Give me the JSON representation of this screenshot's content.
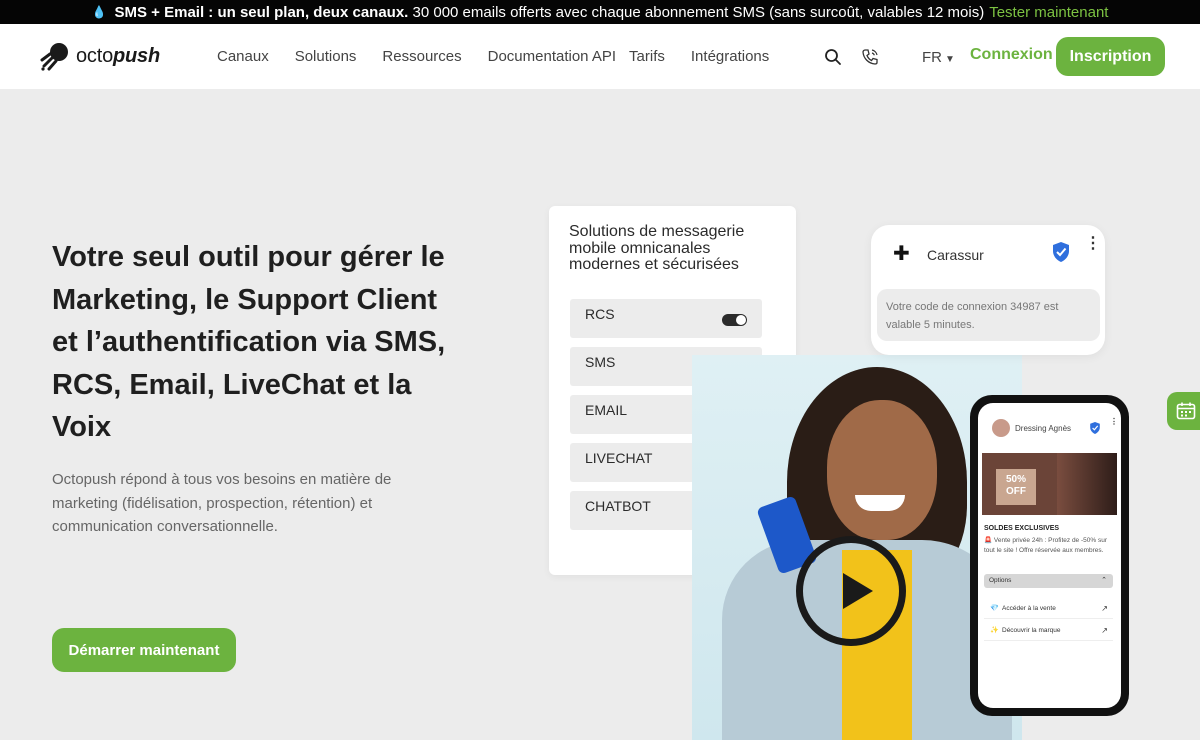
{
  "announcement": {
    "bold": "SMS + Email : un seul plan, deux canaux.",
    "text": "30 000 emails offerts avec chaque abonnement SMS (sans surcoût, valables 12 mois)",
    "cta": "Tester maintenant"
  },
  "header": {
    "logo_light": "octo",
    "logo_bold": "push",
    "nav": [
      "Canaux",
      "Solutions",
      "Ressources",
      "Documentation API",
      "Tarifs",
      "Intégrations"
    ],
    "lang": "FR",
    "login": "Connexion",
    "signup": "Inscription"
  },
  "hero": {
    "title": "Votre seul outil pour gérer le Marketing, le Support Client et l’authentification via SMS, RCS, Email, LiveChat et la Voix",
    "description": "Octopush répond à tous vos besoins en matière de marketing (fidélisation, prospection, rétention) et communication conversationnelle.",
    "cta": "Démarrer maintenant"
  },
  "solutions_card": {
    "title": "Solutions de messagerie mobile omnicanales modernes et sécurisées",
    "channels": [
      "RCS",
      "SMS",
      "EMAIL",
      "LIVECHAT",
      "CHATBOT"
    ]
  },
  "notification": {
    "sender": "Carassur",
    "message": "Votre code de connexion 34987 est valable 5 minutes."
  },
  "phone": {
    "brand": "Dressing Agnès",
    "promo": "50% OFF",
    "sale_title": "SOLDES EXCLUSIVES",
    "sale_text": "🚨 Vente privée 24h : Profitez de -50% sur tout le site ! Offre réservée aux membres.",
    "options_label": "Options",
    "options": [
      "Accéder à la vente",
      "Découvrir la marque"
    ]
  },
  "colors": {
    "brand_green": "#6cb33f",
    "dark": "#1f1f1f",
    "background": "#ececec"
  }
}
